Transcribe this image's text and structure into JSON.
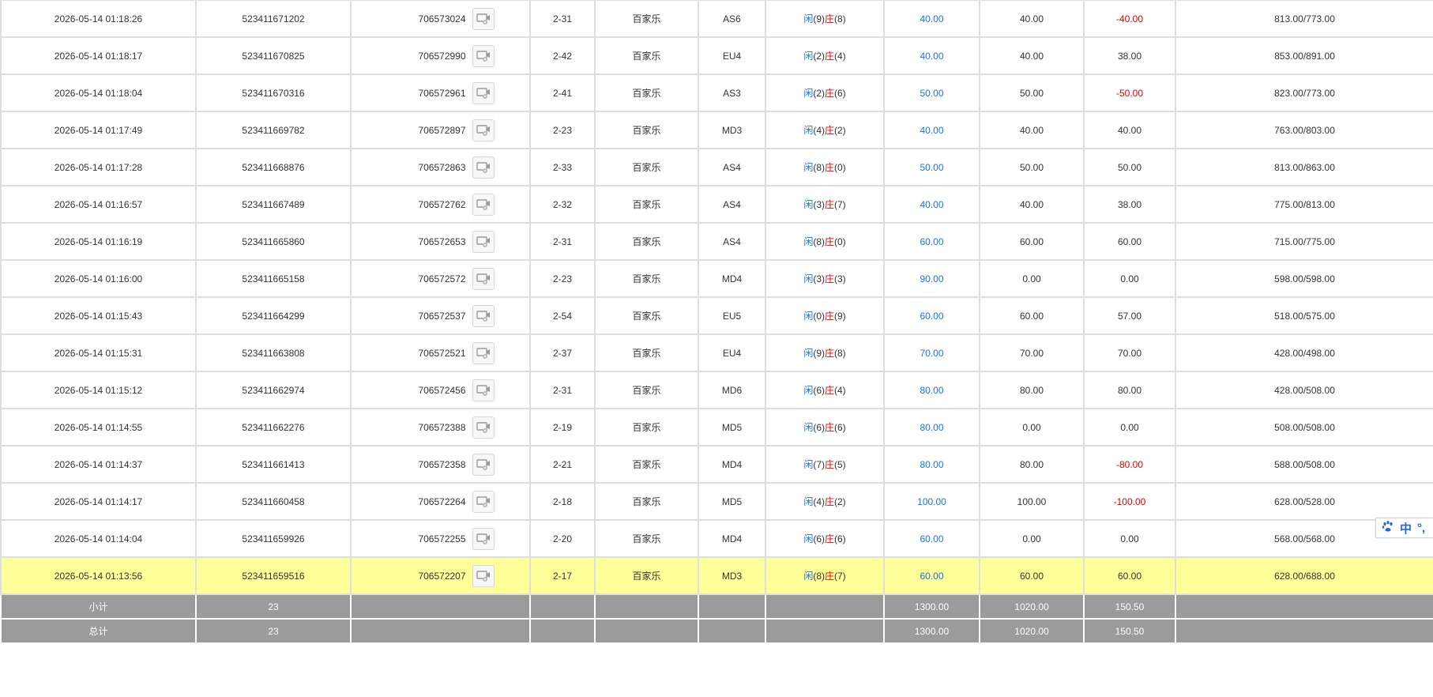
{
  "table": {
    "rows": [
      {
        "time": "2026-05-14 01:18:26",
        "bet_no": "523411671202",
        "round_no": "706573024",
        "shoe": "2-31",
        "game": "百家乐",
        "table": "AS6",
        "player_label": "闲",
        "player_pts": "(9)",
        "banker_label": "庄",
        "banker_pts": "(8)",
        "bet": "40.00",
        "valid": "40.00",
        "win": "-40.00",
        "win_neg": true,
        "balance": "813.00/773.00",
        "highlight": false
      },
      {
        "time": "2026-05-14 01:18:17",
        "bet_no": "523411670825",
        "round_no": "706572990",
        "shoe": "2-42",
        "game": "百家乐",
        "table": "EU4",
        "player_label": "闲",
        "player_pts": "(2)",
        "banker_label": "庄",
        "banker_pts": "(4)",
        "bet": "40.00",
        "valid": "40.00",
        "win": "38.00",
        "win_neg": false,
        "balance": "853.00/891.00",
        "highlight": false
      },
      {
        "time": "2026-05-14 01:18:04",
        "bet_no": "523411670316",
        "round_no": "706572961",
        "shoe": "2-41",
        "game": "百家乐",
        "table": "AS3",
        "player_label": "闲",
        "player_pts": "(2)",
        "banker_label": "庄",
        "banker_pts": "(6)",
        "bet": "50.00",
        "valid": "50.00",
        "win": "-50.00",
        "win_neg": true,
        "balance": "823.00/773.00",
        "highlight": false
      },
      {
        "time": "2026-05-14 01:17:49",
        "bet_no": "523411669782",
        "round_no": "706572897",
        "shoe": "2-23",
        "game": "百家乐",
        "table": "MD3",
        "player_label": "闲",
        "player_pts": "(4)",
        "banker_label": "庄",
        "banker_pts": "(2)",
        "bet": "40.00",
        "valid": "40.00",
        "win": "40.00",
        "win_neg": false,
        "balance": "763.00/803.00",
        "highlight": false
      },
      {
        "time": "2026-05-14 01:17:28",
        "bet_no": "523411668876",
        "round_no": "706572863",
        "shoe": "2-33",
        "game": "百家乐",
        "table": "AS4",
        "player_label": "闲",
        "player_pts": "(8)",
        "banker_label": "庄",
        "banker_pts": "(0)",
        "bet": "50.00",
        "valid": "50.00",
        "win": "50.00",
        "win_neg": false,
        "balance": "813.00/863.00",
        "highlight": false
      },
      {
        "time": "2026-05-14 01:16:57",
        "bet_no": "523411667489",
        "round_no": "706572762",
        "shoe": "2-32",
        "game": "百家乐",
        "table": "AS4",
        "player_label": "闲",
        "player_pts": "(3)",
        "banker_label": "庄",
        "banker_pts": "(7)",
        "bet": "40.00",
        "valid": "40.00",
        "win": "38.00",
        "win_neg": false,
        "balance": "775.00/813.00",
        "highlight": false
      },
      {
        "time": "2026-05-14 01:16:19",
        "bet_no": "523411665860",
        "round_no": "706572653",
        "shoe": "2-31",
        "game": "百家乐",
        "table": "AS4",
        "player_label": "闲",
        "player_pts": "(8)",
        "banker_label": "庄",
        "banker_pts": "(0)",
        "bet": "60.00",
        "valid": "60.00",
        "win": "60.00",
        "win_neg": false,
        "balance": "715.00/775.00",
        "highlight": false
      },
      {
        "time": "2026-05-14 01:16:00",
        "bet_no": "523411665158",
        "round_no": "706572572",
        "shoe": "2-23",
        "game": "百家乐",
        "table": "MD4",
        "player_label": "闲",
        "player_pts": "(3)",
        "banker_label": "庄",
        "banker_pts": "(3)",
        "bet": "90.00",
        "valid": "0.00",
        "win": "0.00",
        "win_neg": false,
        "balance": "598.00/598.00",
        "highlight": false
      },
      {
        "time": "2026-05-14 01:15:43",
        "bet_no": "523411664299",
        "round_no": "706572537",
        "shoe": "2-54",
        "game": "百家乐",
        "table": "EU5",
        "player_label": "闲",
        "player_pts": "(0)",
        "banker_label": "庄",
        "banker_pts": "(9)",
        "bet": "60.00",
        "valid": "60.00",
        "win": "57.00",
        "win_neg": false,
        "balance": "518.00/575.00",
        "highlight": false
      },
      {
        "time": "2026-05-14 01:15:31",
        "bet_no": "523411663808",
        "round_no": "706572521",
        "shoe": "2-37",
        "game": "百家乐",
        "table": "EU4",
        "player_label": "闲",
        "player_pts": "(9)",
        "banker_label": "庄",
        "banker_pts": "(8)",
        "bet": "70.00",
        "valid": "70.00",
        "win": "70.00",
        "win_neg": false,
        "balance": "428.00/498.00",
        "highlight": false
      },
      {
        "time": "2026-05-14 01:15:12",
        "bet_no": "523411662974",
        "round_no": "706572456",
        "shoe": "2-31",
        "game": "百家乐",
        "table": "MD6",
        "player_label": "闲",
        "player_pts": "(6)",
        "banker_label": "庄",
        "banker_pts": "(4)",
        "bet": "80.00",
        "valid": "80.00",
        "win": "80.00",
        "win_neg": false,
        "balance": "428.00/508.00",
        "highlight": false
      },
      {
        "time": "2026-05-14 01:14:55",
        "bet_no": "523411662276",
        "round_no": "706572388",
        "shoe": "2-19",
        "game": "百家乐",
        "table": "MD5",
        "player_label": "闲",
        "player_pts": "(6)",
        "banker_label": "庄",
        "banker_pts": "(6)",
        "bet": "80.00",
        "valid": "0.00",
        "win": "0.00",
        "win_neg": false,
        "balance": "508.00/508.00",
        "highlight": false
      },
      {
        "time": "2026-05-14 01:14:37",
        "bet_no": "523411661413",
        "round_no": "706572358",
        "shoe": "2-21",
        "game": "百家乐",
        "table": "MD4",
        "player_label": "闲",
        "player_pts": "(7)",
        "banker_label": "庄",
        "banker_pts": "(5)",
        "bet": "80.00",
        "valid": "80.00",
        "win": "-80.00",
        "win_neg": true,
        "balance": "588.00/508.00",
        "highlight": false
      },
      {
        "time": "2026-05-14 01:14:17",
        "bet_no": "523411660458",
        "round_no": "706572264",
        "shoe": "2-18",
        "game": "百家乐",
        "table": "MD5",
        "player_label": "闲",
        "player_pts": "(4)",
        "banker_label": "庄",
        "banker_pts": "(2)",
        "bet": "100.00",
        "valid": "100.00",
        "win": "-100.00",
        "win_neg": true,
        "balance": "628.00/528.00",
        "highlight": false
      },
      {
        "time": "2026-05-14 01:14:04",
        "bet_no": "523411659926",
        "round_no": "706572255",
        "shoe": "2-20",
        "game": "百家乐",
        "table": "MD4",
        "player_label": "闲",
        "player_pts": "(6)",
        "banker_label": "庄",
        "banker_pts": "(6)",
        "bet": "60.00",
        "valid": "0.00",
        "win": "0.00",
        "win_neg": false,
        "balance": "568.00/568.00",
        "highlight": false
      },
      {
        "time": "2026-05-14 01:13:56",
        "bet_no": "523411659516",
        "round_no": "706572207",
        "shoe": "2-17",
        "game": "百家乐",
        "table": "MD3",
        "player_label": "闲",
        "player_pts": "(8)",
        "banker_label": "庄",
        "banker_pts": "(7)",
        "bet": "60.00",
        "valid": "60.00",
        "win": "60.00",
        "win_neg": false,
        "balance": "628.00/688.00",
        "highlight": true
      }
    ],
    "subtotal": {
      "label": "小计",
      "count": "23",
      "bet": "1300.00",
      "valid": "1020.00",
      "win": "150.50"
    },
    "total": {
      "label": "总计",
      "count": "23",
      "bet": "1300.00",
      "valid": "1020.00",
      "win": "150.50"
    }
  },
  "ime_toolbar": {
    "icon": "paw-icon",
    "mode_label": "中",
    "punct_label": "°,"
  },
  "colors": {
    "blue": "#1a73e8",
    "red": "#e00000",
    "highlight": "#ffff99",
    "summary_bg": "#9b9b9b"
  }
}
